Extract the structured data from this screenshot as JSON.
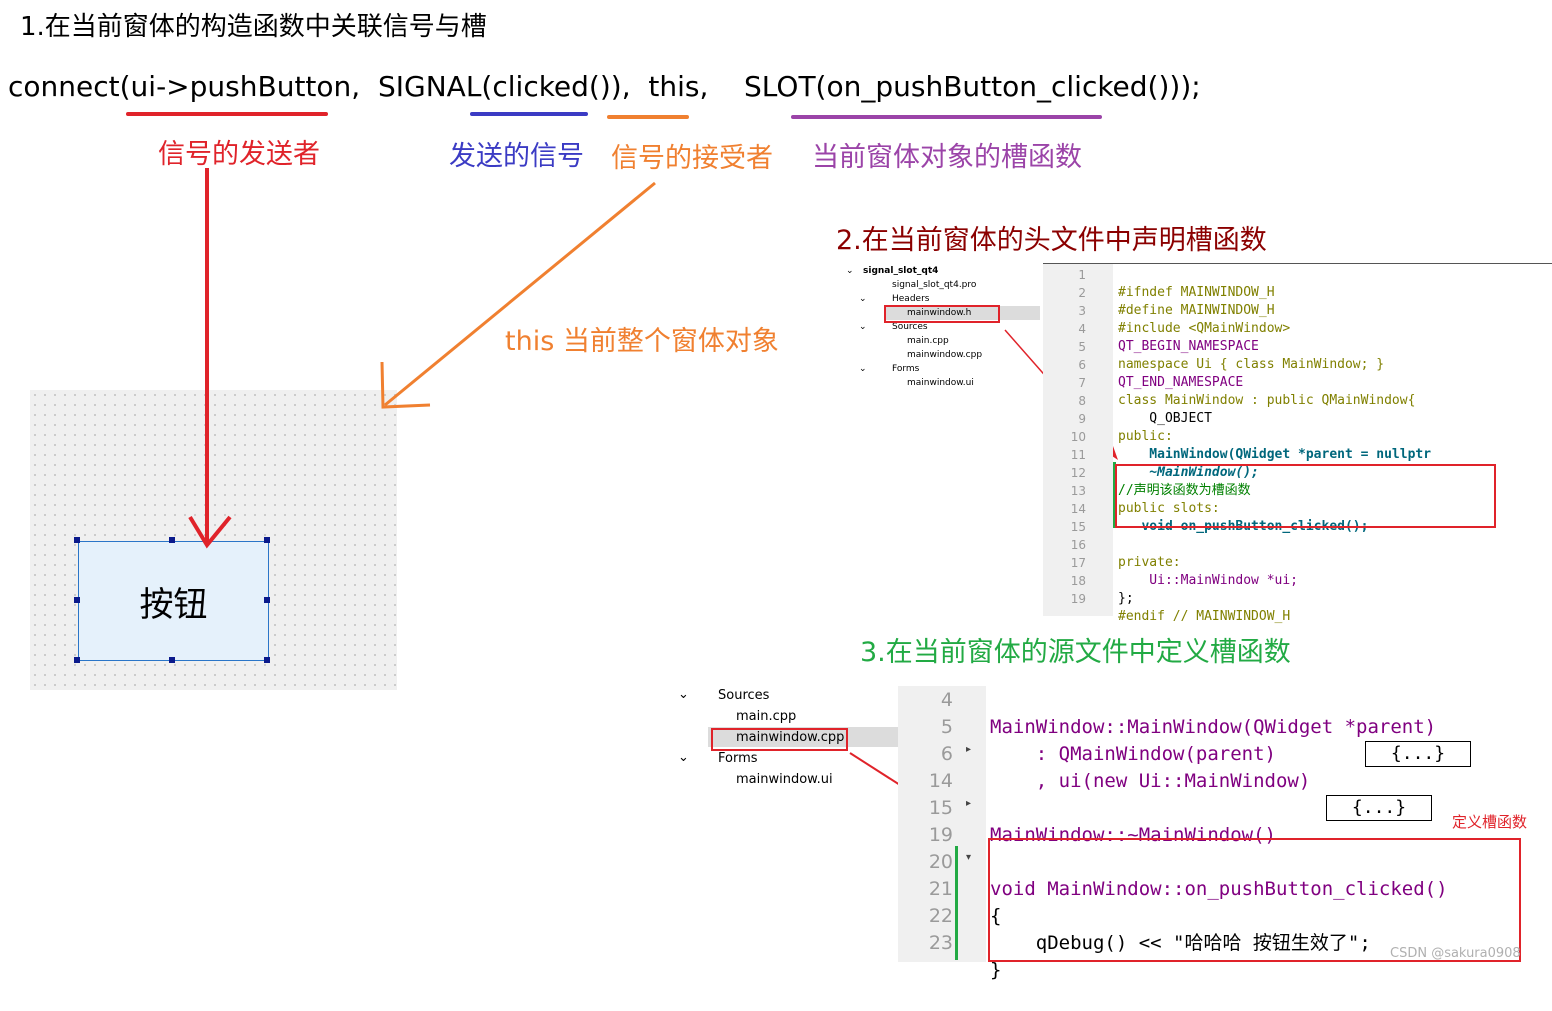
{
  "step1": {
    "title": "1.在当前窗体的构造函数中关联信号与槽"
  },
  "connect": {
    "part1": "connect(",
    "sender": "ui->pushButton,",
    "part2": "SIGNAL(",
    "signal": "clicked()",
    "part3": "),",
    "receiver": "this,",
    "slot": "SLOT(on_pushButton_clicked()));"
  },
  "labels": {
    "sender": "信号的发送者",
    "signal": "发送的信号",
    "receiver": "信号的接受者",
    "slot": "当前窗体对象的槽函数",
    "this_note": "this 当前整个窗体对象"
  },
  "colors": {
    "sender": "#e0232a",
    "signal": "#3b3bc4",
    "receiver": "#f08030",
    "slot": "#9b44a8",
    "step2": "#8b0000",
    "step3": "#22aa44"
  },
  "button": {
    "label": "按钮"
  },
  "step2": {
    "title": "2.在当前窗体的头文件中声明槽函数",
    "tree": [
      "signal_slot_qt4",
      "signal_slot_qt4.pro",
      "Headers",
      "mainwindow.h",
      "Sources",
      "main.cpp",
      "mainwindow.cpp",
      "Forms",
      "mainwindow.ui"
    ],
    "line_numbers": [
      "1",
      "2",
      "3",
      "4",
      "5",
      "6",
      "7",
      "8",
      "9",
      "10",
      "11",
      "12",
      "13",
      "14",
      "15",
      "16",
      "17",
      "18",
      "19"
    ],
    "code": [
      "#ifndef MAINWINDOW_H",
      "#define MAINWINDOW_H",
      "#include <QMainWindow>",
      "QT_BEGIN_NAMESPACE",
      "namespace Ui { class MainWindow; }",
      "QT_END_NAMESPACE",
      "class MainWindow : public QMainWindow{",
      "    Q_OBJECT",
      "public:",
      "    MainWindow(QWidget *parent = nullptr",
      "    ~MainWindow();",
      "//声明该函数为槽函数",
      "public slots:",
      "   void on_pushButton_clicked();",
      "",
      "private:",
      "    Ui::MainWindow *ui;",
      "};",
      "#endif // MAINWINDOW_H"
    ]
  },
  "step3": {
    "title": "3.在当前窗体的源文件中定义槽函数",
    "tree": [
      "Sources",
      "main.cpp",
      "mainwindow.cpp",
      "Forms",
      "mainwindow.ui"
    ],
    "line_numbers": [
      "4",
      "5",
      "6",
      "14",
      "15",
      "19",
      "20",
      "21",
      "22",
      "23"
    ],
    "code": [
      "MainWindow::MainWindow(QWidget *parent)",
      "    : QMainWindow(parent)",
      "    , ui(new Ui::MainWindow)",
      "",
      "MainWindow::~MainWindow()",
      "",
      "void MainWindow::on_pushButton_clicked()",
      "{",
      "    qDebug() << \"哈哈哈 按钮生效了\";",
      "}"
    ],
    "folded": "{...}",
    "note": "定义槽函数"
  },
  "watermark": "CSDN @sakura0908"
}
